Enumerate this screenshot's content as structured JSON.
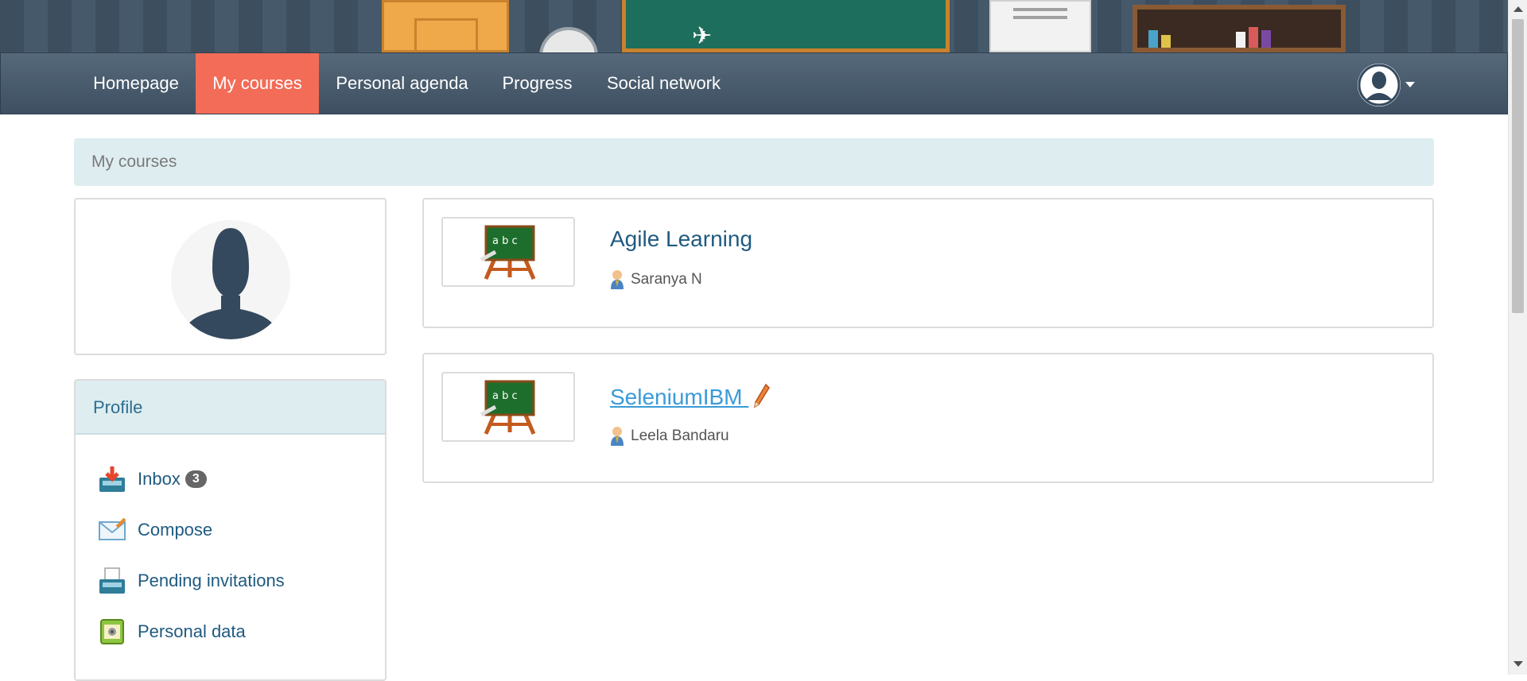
{
  "nav": {
    "items": [
      {
        "label": "Homepage"
      },
      {
        "label": "My courses",
        "active": true
      },
      {
        "label": "Personal agenda"
      },
      {
        "label": "Progress"
      },
      {
        "label": "Social network"
      }
    ],
    "active_color": "#f26c57"
  },
  "breadcrumb": {
    "label": "My courses"
  },
  "profile": {
    "title": "Profile",
    "items": [
      {
        "label": "Inbox",
        "icon": "inbox-icon",
        "badge": "3"
      },
      {
        "label": "Compose",
        "icon": "compose-icon"
      },
      {
        "label": "Pending invitations",
        "icon": "invitations-icon"
      },
      {
        "label": "Personal data",
        "icon": "personal-data-icon"
      }
    ]
  },
  "courses": [
    {
      "title": "Agile Learning",
      "teacher": "Saranya N",
      "icon": "blackboard-icon"
    },
    {
      "title": "SeleniumIBM",
      "teacher": "Leela Bandaru",
      "icon": "blackboard-icon",
      "editable": true
    }
  ],
  "colors": {
    "navbar": "#46596a",
    "link": "#1f5a80",
    "breadcrumb_bg": "#deedf0"
  }
}
